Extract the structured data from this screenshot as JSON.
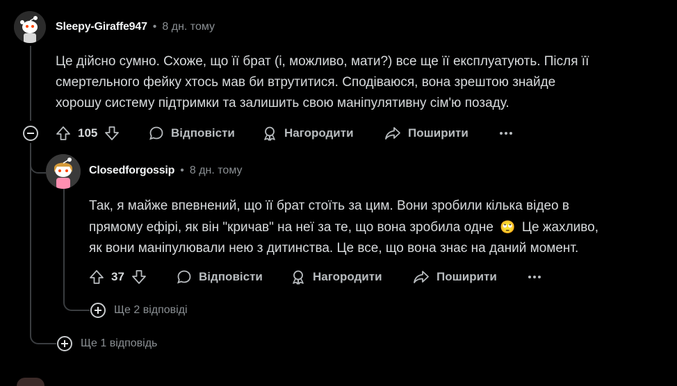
{
  "comments": [
    {
      "username": "Sleepy-Giraffe947",
      "separator": "•",
      "time": "8 дн. тому",
      "body": [
        "Це дійсно сумно. Схоже, що її брат (і, можливо, мати?) все ще її експлуатують. Після її",
        "смертельного фейку хтось мав би втрутитися. Сподіваюся, вона зрештою знайде",
        "хорошу систему підтримки та залишить свою маніпулятивну сім'ю позаду."
      ],
      "votes": "105",
      "reply_label": "Відповісти",
      "award_label": "Нагородити",
      "share_label": "Поширити",
      "more_replies_label": "Ще 1 відповідь",
      "collapse_symbol": "−"
    },
    {
      "username": "Closedforgossip",
      "separator": "•",
      "time": "8 дн. тому",
      "body": [
        "Так, я майже впевнений, що її брат стоїть за цим. Вони зробили кілька відео в",
        "прямому ефірі, як він \"кричав\" на неї за те, що вона зробила одне",
        "Це жахливо,",
        "як вони маніпулювали нею з дитинства. Це все, що вона знає на даний момент."
      ],
      "emoji": "🙄",
      "votes": "37",
      "reply_label": "Відповісти",
      "award_label": "Нагородити",
      "share_label": "Поширити",
      "more_replies_label": "Ще 2 відповіді"
    }
  ],
  "icons": {
    "upvote": "upvote-arrow-icon",
    "downvote": "downvote-arrow-icon",
    "reply": "speech-bubble-icon",
    "award": "award-ribbon-icon",
    "share": "share-arrow-icon",
    "more": "ellipsis-icon",
    "expand": "plus-circle-icon",
    "collapse": "minus-circle-icon"
  },
  "colors": {
    "background": "#000000",
    "text": "#d7dadc",
    "muted": "#8a8f93",
    "thread_line": "#3a3d40"
  }
}
